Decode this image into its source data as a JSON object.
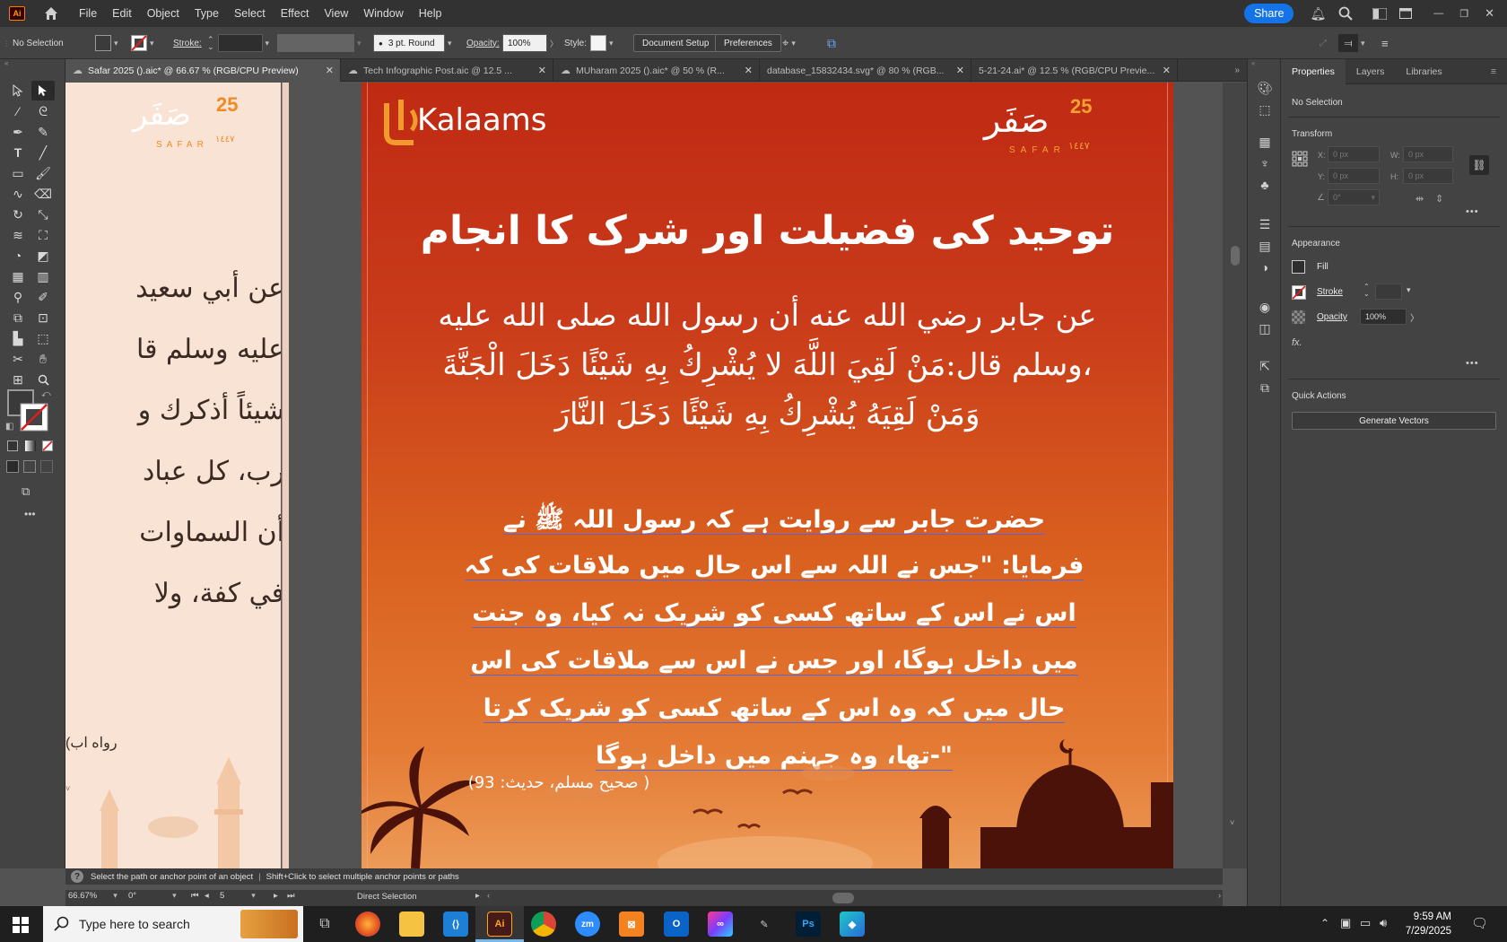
{
  "app": {
    "logo": "Ai",
    "menus": [
      "File",
      "Edit",
      "Object",
      "Type",
      "Select",
      "Effect",
      "View",
      "Window",
      "Help"
    ],
    "share_label": "Share"
  },
  "controlbar": {
    "selection": "No Selection",
    "stroke_label": "Stroke:",
    "brush": "3 pt. Round",
    "opacity_label": "Opacity:",
    "opacity_value": "100%",
    "style_label": "Style:",
    "document_setup": "Document Setup",
    "preferences": "Preferences"
  },
  "tabs": [
    {
      "label": "Safar 2025 ().aic* @ 66.67 % (RGB/CPU Preview)",
      "cloud": true,
      "active": true
    },
    {
      "label": "Tech Infographic Post.aic @ 12.5 ...",
      "cloud": true,
      "active": false
    },
    {
      "label": "MUharam 2025 ().aic* @ 50 % (R...",
      "cloud": true,
      "active": false
    },
    {
      "label": "database_15832434.svg* @ 80 % (RGB...",
      "cloud": false,
      "active": false
    },
    {
      "label": "5-21-24.ai* @ 12.5 % (RGB/CPU Previe...",
      "cloud": false,
      "active": false
    }
  ],
  "artboard_left": {
    "logo_number": "25",
    "logo_text": "صَفَر",
    "logo_sub": "SAFAR",
    "logo_year": "١٤٤٧",
    "lines": [
      "عن أبي سعيد",
      "عليه وسلم قا",
      "شيئاً أذكرك و",
      "رب، كل عباد",
      "أن السماوات",
      "في كفة، ولا"
    ],
    "ref": "(رواه اب"
  },
  "artboard_main": {
    "brand": "Kalaams",
    "brand_mark": "كلام",
    "logo_number": "25",
    "logo_text": "صَفَر",
    "logo_sub": "SAFAR",
    "logo_year": "١٤٤٧",
    "title": "توحید کی فضیلت اور شرک کا انجام",
    "arabic": [
      "عن جابر رضي الله عنه أن رسول الله صلى الله عليه",
      "وسلم قال:مَنْ لَقِيَ اللَّهَ لا يُشْرِكُ بِهِ شَيْئًا دَخَلَ الْجَنَّةَ،",
      "وَمَنْ لَقِيَهُ يُشْرِكُ بِهِ شَيْئًا دَخَلَ النَّارَ"
    ],
    "urdu": [
      "حضرت جابر سے روایت ہے کہ رسول اللہ ﷺ نے",
      "فرمایا: \"جس نے اللہ سے اس حال میں ملاقات کی کہ",
      "اس نے اس کے ساتھ کسی کو شریک نہ کیا، وہ جنت",
      "میں داخل ہوگا، اور جس نے اس سے ملاقات کی اس",
      "حال میں کہ وہ اس کے ساتھ کسی کو شریک کرتا",
      "تھا، وہ جہنم میں داخل ہوگا-\""
    ],
    "reference": "(صحیح مسلم، حدیث: 93 )"
  },
  "properties": {
    "tabs": [
      "Properties",
      "Layers",
      "Libraries"
    ],
    "selection": "No Selection",
    "transform_title": "Transform",
    "x_label": "X:",
    "x_value": "0 px",
    "y_label": "Y:",
    "y_value": "0 px",
    "w_label": "W:",
    "w_value": "0 px",
    "h_label": "H:",
    "h_value": "0 px",
    "angle_value": "0°",
    "appearance_title": "Appearance",
    "fill_label": "Fill",
    "stroke_label": "Stroke",
    "opacity_label": "Opacity",
    "opacity_value": "100%",
    "fx_label": "fx.",
    "quick_actions_title": "Quick Actions",
    "generate_vectors": "Generate Vectors"
  },
  "status": {
    "hint_before": "Select the path or anchor point of an object",
    "hint_after": "Shift+Click to select multiple anchor points or paths",
    "zoom": "66.67%",
    "rotation": "0°",
    "artboard_number": "5",
    "tool_name": "Direct Selection"
  },
  "taskbar": {
    "search_placeholder": "Type here to search",
    "time": "9:59 AM",
    "date": "7/29/2025"
  }
}
